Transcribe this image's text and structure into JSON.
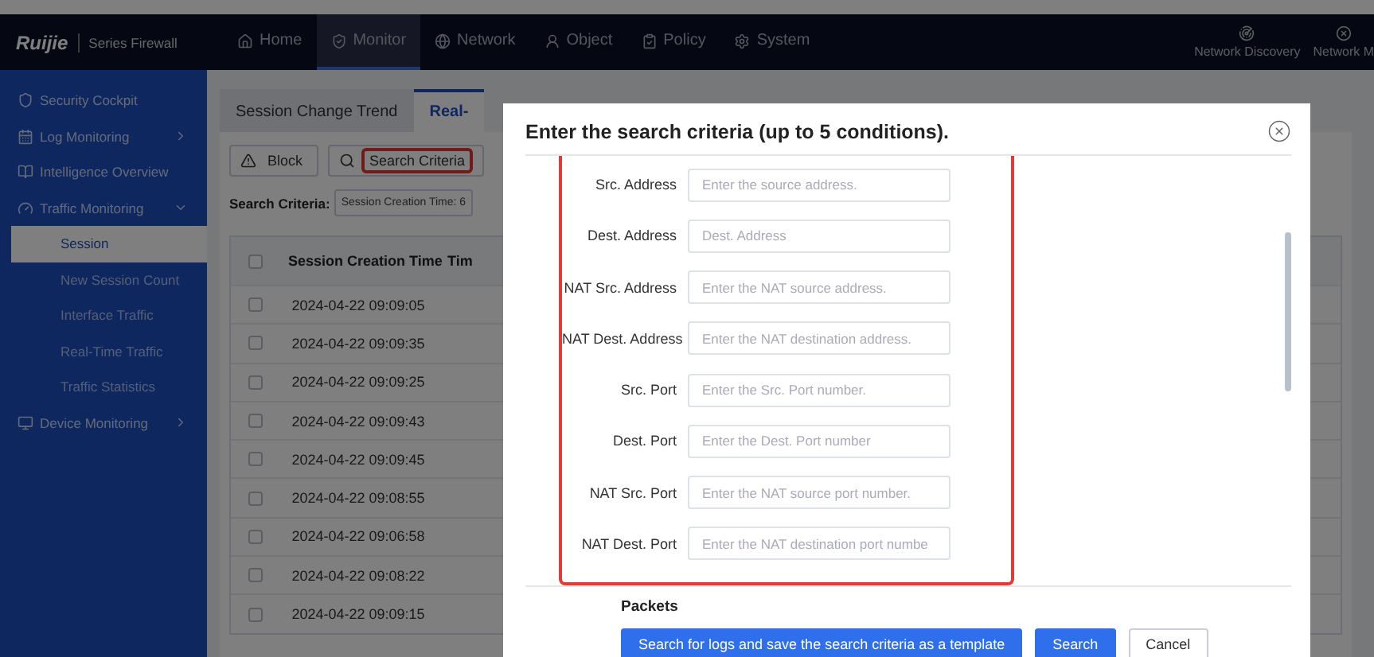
{
  "navbar": {
    "brand": "Ruijie",
    "product": "Series Firewall",
    "items": [
      {
        "label": "Home",
        "selected": false
      },
      {
        "label": "Monitor",
        "selected": true
      },
      {
        "label": "Network",
        "selected": false
      },
      {
        "label": "Object",
        "selected": false
      },
      {
        "label": "Policy",
        "selected": false
      },
      {
        "label": "System",
        "selected": false
      }
    ],
    "tools": [
      {
        "label": "Network Discovery"
      },
      {
        "label": "Network M"
      }
    ]
  },
  "sidebar": {
    "items": [
      {
        "label": "Security Cockpit"
      },
      {
        "label": "Log Monitoring",
        "expanded": false
      },
      {
        "label": "Intelligence Overview"
      },
      {
        "label": "Traffic Monitoring",
        "expanded": true,
        "children": [
          {
            "label": "Session",
            "selected": true
          },
          {
            "label": "New Session Count",
            "selected": false
          },
          {
            "label": "Interface Traffic",
            "selected": false
          },
          {
            "label": "Real-Time Traffic",
            "selected": false
          },
          {
            "label": "Traffic Statistics",
            "selected": false
          }
        ]
      },
      {
        "label": "Device Monitoring",
        "expanded": false
      }
    ]
  },
  "content": {
    "tabs": [
      {
        "label": "Session Change Trend",
        "selected": false
      },
      {
        "label": "Real-",
        "selected": true
      }
    ],
    "toolbar": [
      {
        "label": "Block",
        "kind": "block",
        "highlighted": false
      },
      {
        "label": "Search Criteria",
        "kind": "search",
        "highlighted": true
      }
    ],
    "search_criteria": {
      "label": "Search Criteria:",
      "value": "Session Creation Time: 6"
    },
    "table": {
      "all_checked": false,
      "columns": [
        "Session Creation Time",
        "Tim"
      ],
      "rows": [
        {
          "time": "2024-04-22 09:09:05",
          "checked": false
        },
        {
          "time": "2024-04-22 09:09:35",
          "checked": false
        },
        {
          "time": "2024-04-22 09:09:25",
          "checked": false
        },
        {
          "time": "2024-04-22 09:09:43",
          "checked": false
        },
        {
          "time": "2024-04-22 09:09:45",
          "checked": false
        },
        {
          "time": "2024-04-22 09:08:55",
          "checked": false
        },
        {
          "time": "2024-04-22 09:06:58",
          "checked": false
        },
        {
          "time": "2024-04-22 09:08:22",
          "checked": false
        },
        {
          "time": "2024-04-22 09:09:15",
          "checked": false
        }
      ]
    }
  },
  "dialog": {
    "title": "Enter the search criteria (up to 5 conditions).",
    "highlighted": true,
    "fields": [
      {
        "label": "Src. Address",
        "placeholder": "Enter the source address."
      },
      {
        "label": "Dest. Address",
        "placeholder": "Dest. Address"
      },
      {
        "label": "NAT Src. Address",
        "placeholder": "Enter the NAT source address."
      },
      {
        "label": "NAT Dest. Address",
        "placeholder": "Enter the NAT destination address."
      },
      {
        "label": "Src. Port",
        "placeholder": "Enter the Src. Port number."
      },
      {
        "label": "Dest. Port",
        "placeholder": "Enter the Dest. Port number"
      },
      {
        "label": "NAT Src. Port",
        "placeholder": "Enter the NAT source port number."
      },
      {
        "label": "NAT Dest. Port",
        "placeholder": "Enter the NAT destination port numbe"
      }
    ],
    "section": "Packets",
    "buttons": [
      {
        "label": "Search for logs and save the search criteria as a template",
        "kind": "primary"
      },
      {
        "label": "Search",
        "kind": "primary"
      },
      {
        "label": "Cancel",
        "kind": "default"
      }
    ]
  }
}
